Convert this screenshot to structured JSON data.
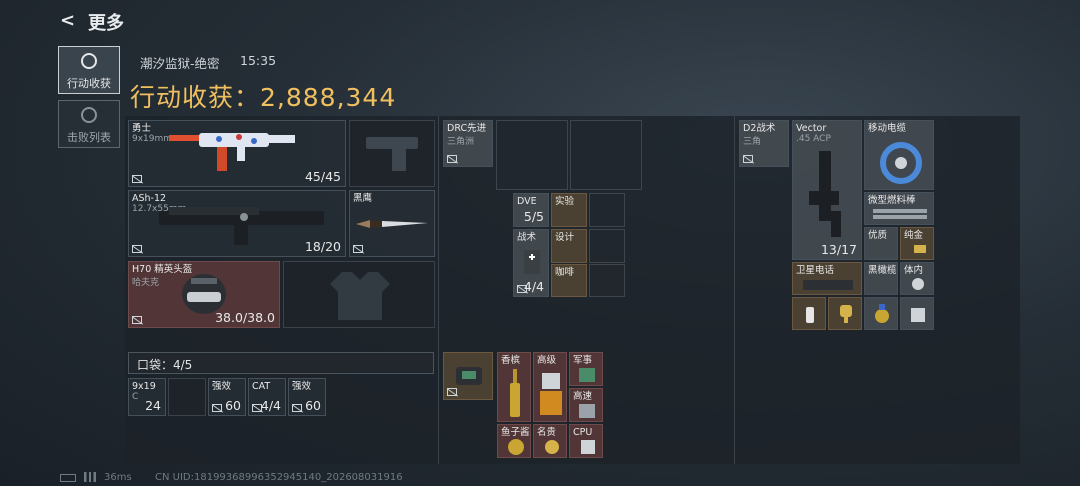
{
  "header": {
    "back_icon": "<",
    "title": "更多"
  },
  "side_tabs": [
    {
      "label": "行动收获",
      "active": true
    },
    {
      "label": "击败列表",
      "active": false
    }
  ],
  "match": {
    "map": "潮汐监狱-绝密",
    "time": "15:35"
  },
  "loot": {
    "title": "行动收获：2,888,344"
  },
  "weapons": {
    "primary": {
      "name": "勇士",
      "sub": "9x19mm",
      "count": "45/45"
    },
    "secondary": {
      "name": "ASh-12",
      "sub": "12.7x55mm",
      "count": "18/20"
    },
    "melee": {
      "name": "黑鹰"
    }
  },
  "helmet": {
    "name": "H70 精英头盔",
    "sub": "哈夫克",
    "durability": "38.0/38.0"
  },
  "pocket": {
    "label": "口袋：4/5"
  },
  "pocket_items": [
    {
      "name": "9x19",
      "sub": "C",
      "count": "24"
    },
    {
      "name": "强效",
      "count": "60"
    },
    {
      "name": "CAT",
      "count": "4/4"
    },
    {
      "name": "强效",
      "count": "60"
    }
  ],
  "chest_rig": {
    "name": "DRC先进",
    "sub": "三角洲",
    "items": [
      {
        "name": "DVE",
        "count": "5/5"
      },
      {
        "name": "实验"
      },
      {
        "name": "战术",
        "count": "4/4"
      },
      {
        "name": "设计"
      },
      {
        "name": "咖啡"
      }
    ]
  },
  "backpack": {
    "items": [
      {
        "name": "香槟"
      },
      {
        "name": "高级"
      },
      {
        "name": "军事"
      },
      {
        "name": "高速"
      },
      {
        "name": "鱼子酱"
      },
      {
        "name": "名贵"
      },
      {
        "name": "CPU"
      }
    ]
  },
  "safe_box": {
    "name": "D2战术",
    "sub": "三角",
    "items": [
      {
        "name": "Vector",
        "sub": ".45 ACP",
        "count": "13/17"
      },
      {
        "name": "移动电缆"
      },
      {
        "name": "微型燃料棒"
      },
      {
        "name": "优质"
      },
      {
        "name": "纯金"
      },
      {
        "name": "卫星电话"
      },
      {
        "name": "黑橄榄"
      },
      {
        "name": "体内"
      }
    ]
  },
  "footer": {
    "ping": "36ms",
    "uid": "CN UID:18199368996352945140_202608031916"
  }
}
